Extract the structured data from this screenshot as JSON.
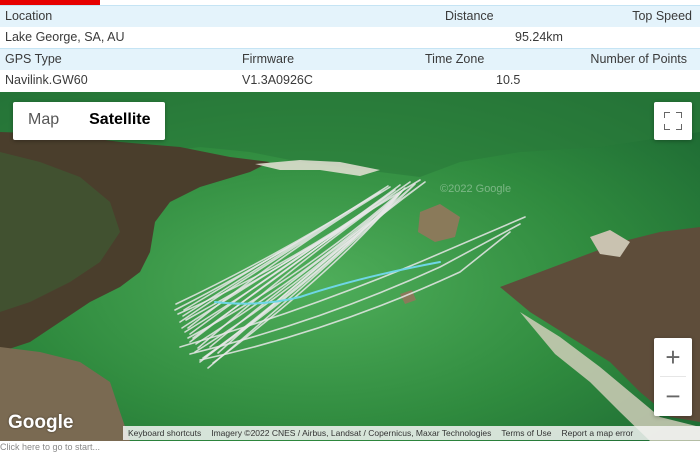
{
  "stats": {
    "row1_headers": {
      "location": "Location",
      "distance": "Distance",
      "top_speed": "Top Speed"
    },
    "row1_values": {
      "location": "Lake George, SA, AU",
      "distance": "95.24km",
      "top_speed": ""
    },
    "row2_headers": {
      "gps_type": "GPS Type",
      "firmware": "Firmware",
      "time_zone": "Time Zone",
      "num_points": "Number of Points"
    },
    "row2_values": {
      "gps_type": "Navilink.GW60",
      "firmware": "V1.3A0926C",
      "time_zone": "10.5",
      "num_points": ""
    }
  },
  "map": {
    "map_type": {
      "map": "Map",
      "satellite": "Satellite",
      "selected": "Satellite"
    },
    "fullscreen_icon": "fullscreen-icon",
    "zoom_in": "+",
    "zoom_out": "−",
    "logo": "Google",
    "attribution": {
      "shortcuts": "Keyboard shortcuts",
      "imagery": "Imagery ©2022 CNES / Airbus, Landsat / Copernicus, Maxar Technologies",
      "terms": "Terms of Use",
      "report": "Report a map error"
    },
    "watermark": "©2022 Google",
    "colors": {
      "track": "#e8e8e8",
      "track_highlight": "#6fd6e6",
      "water": "#2f8a3e",
      "land": "#5a4a36"
    }
  },
  "footer_text": "Click here to go to start..."
}
